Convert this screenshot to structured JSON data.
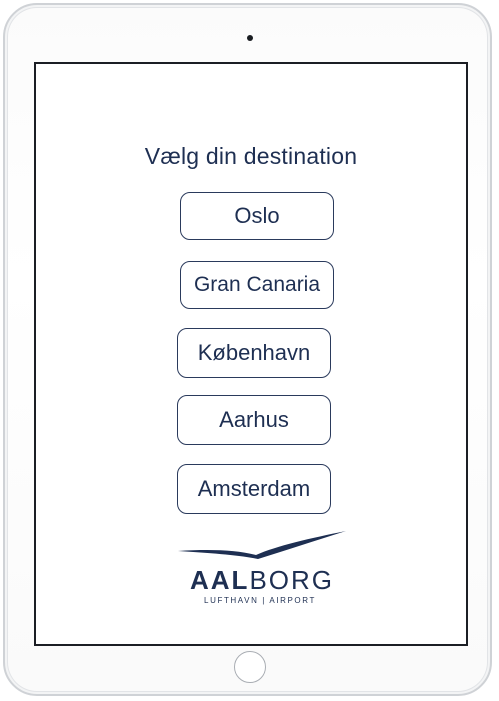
{
  "screen": {
    "title": "Vælg din destination",
    "destinations": [
      {
        "label": "Oslo"
      },
      {
        "label": "Gran Canaria"
      },
      {
        "label": "København"
      },
      {
        "label": "Aarhus"
      },
      {
        "label": "Amsterdam"
      }
    ]
  },
  "logo": {
    "wordmark_bold": "AAL",
    "wordmark_light": "BORG",
    "subtitle": "LUFTHAVN | AIRPORT",
    "color": "#1e2f52"
  },
  "colors": {
    "text_primary": "#1e2f52",
    "button_border": "#2a3a5c",
    "screen_bg": "#ffffff"
  }
}
